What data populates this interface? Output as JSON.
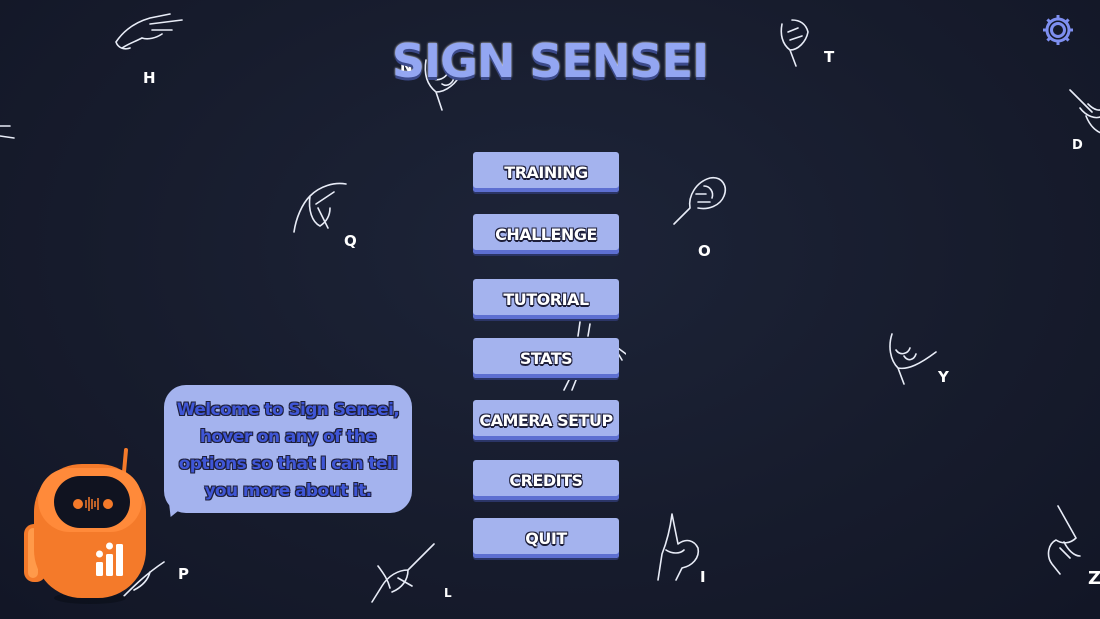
{
  "app": {
    "title": "SIGN SENSEI"
  },
  "settings": {
    "icon": "gear-icon"
  },
  "menu": {
    "training": "TRAINING",
    "challenge": "CHALLENGE",
    "tutorial": "TUTORIAL",
    "stats": "STATS",
    "camera_setup": "CAMERA SETUP",
    "credits": "CREDITS",
    "quit": "QUIT"
  },
  "assistant": {
    "message": "Welcome to Sign Sensei, hover on any of the options so that I can tell you more about it."
  },
  "background_letters": [
    "H",
    "N",
    "T",
    "D",
    "Q",
    "O",
    "Y",
    "P",
    "L",
    "I",
    "Z"
  ],
  "colors": {
    "background": "#171c2d",
    "button": "#a4b3ee",
    "title": "#93a6f2",
    "robot": "#f47a2a"
  }
}
